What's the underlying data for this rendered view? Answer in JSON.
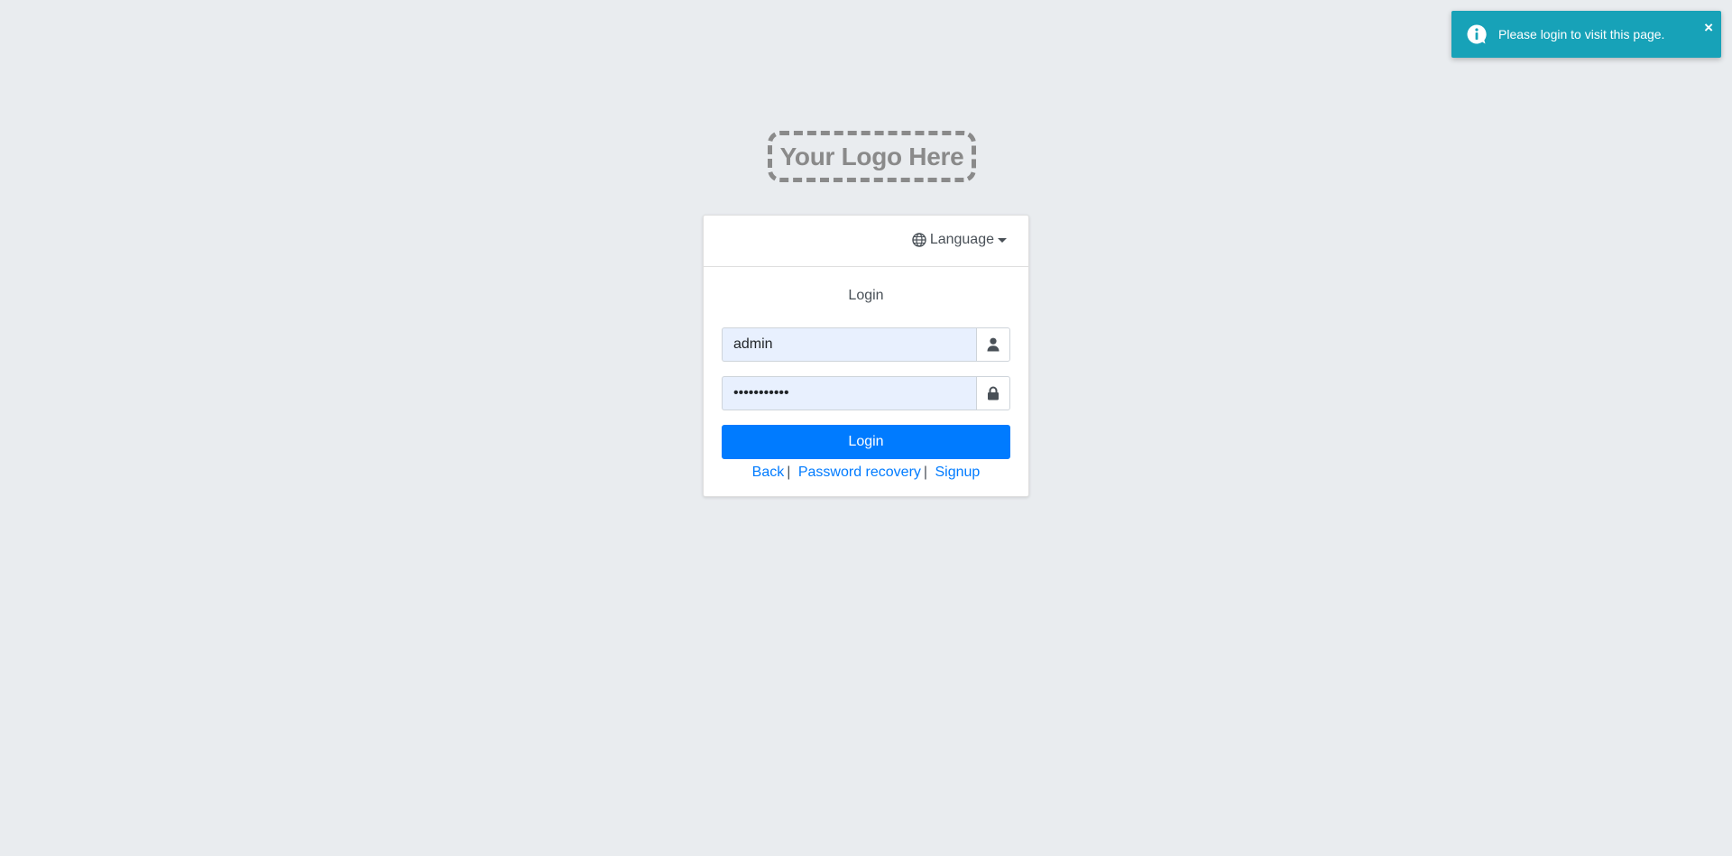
{
  "toast": {
    "message": "Please login to visit this page.",
    "close_label": "×",
    "icon": "info-icon",
    "color": "#17a2b8"
  },
  "logo": {
    "text": "Your Logo Here"
  },
  "language": {
    "label": "Language",
    "icon": "globe-icon"
  },
  "login": {
    "title": "Login",
    "username_value": "admin",
    "password_value": "•••••••••••",
    "username_icon": "user-icon",
    "password_icon": "lock-icon",
    "button_label": "Login",
    "button_color": "#007bff"
  },
  "links": {
    "back": "Back",
    "password_recovery": "Password recovery",
    "signup": "Signup",
    "separator": "|"
  }
}
